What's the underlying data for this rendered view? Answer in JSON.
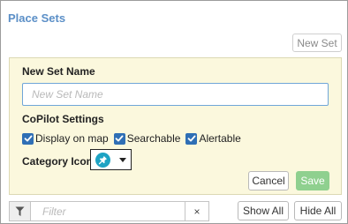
{
  "panel": {
    "title": "Place Sets",
    "new_set_button": "New Set"
  },
  "form": {
    "name_label": "New Set Name",
    "name_placeholder": "New Set Name",
    "name_value": "",
    "copilot_label": "CoPilot Settings",
    "checkboxes": [
      {
        "label": "Display on map",
        "checked": true
      },
      {
        "label": "Searchable",
        "checked": true
      },
      {
        "label": "Alertable",
        "checked": true
      }
    ],
    "category_label": "Category Icon",
    "category_icon": "pin-icon",
    "cancel_label": "Cancel",
    "save_label": "Save"
  },
  "filter": {
    "icon": "funnel-icon",
    "placeholder": "Filter",
    "clear_glyph": "×"
  },
  "footer": {
    "show_all_label": "Show All",
    "hide_all_label": "Hide All"
  },
  "colors": {
    "title": "#5b8fc7",
    "form_background": "#fbf8dd",
    "checkbox": "#2f6fb5",
    "icon_accent": "#1ea3c4",
    "save_button": "#8fd08f"
  }
}
